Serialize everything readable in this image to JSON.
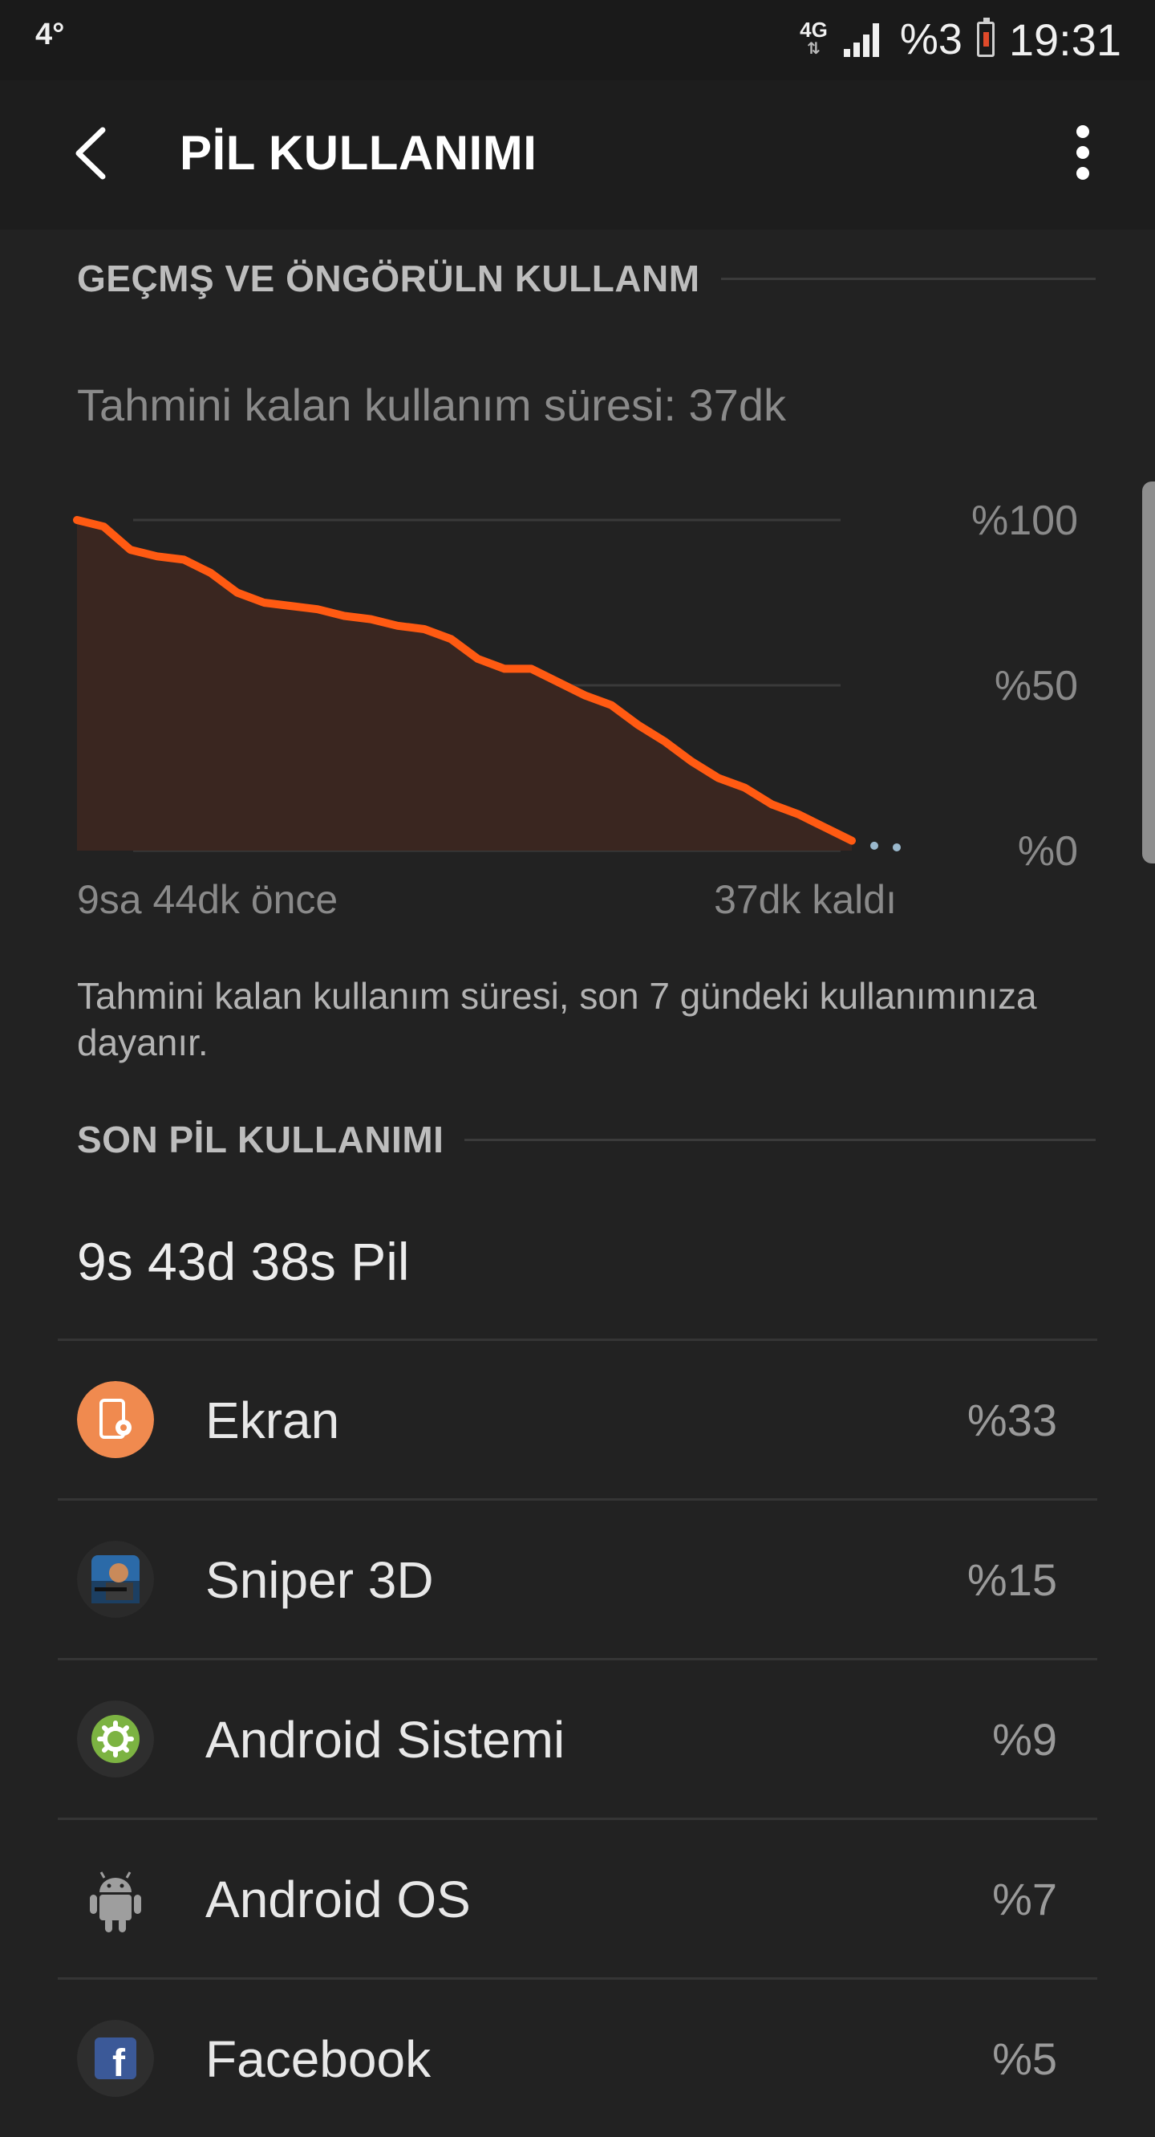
{
  "status_bar": {
    "temperature": "4°",
    "network_type": "4G",
    "battery_percent": "%3",
    "time": "19:31"
  },
  "app_bar": {
    "title": "PİL KULLANIMI"
  },
  "history_section": {
    "header": "GEÇMŞ VE ÖNGÖRÜLN KULLANM",
    "estimate": "Tahmini kalan kullanım süresi: 37dk",
    "caption": "Tahmini kalan kullanım süresi, son 7 gündeki kullanımınıza dayanır."
  },
  "chart_data": {
    "type": "area",
    "x_start_label": "9sa 44dk önce",
    "x_end_label": "37dk kaldı",
    "y_tick_labels": [
      "%100",
      "%50",
      "%0"
    ],
    "ylim": [
      0,
      100
    ],
    "grid": true,
    "series": [
      {
        "values": [
          100,
          98,
          91,
          89,
          88,
          84,
          78,
          75,
          74,
          73,
          71,
          70,
          68,
          67,
          64,
          58,
          55,
          55,
          51,
          47,
          44,
          38,
          33,
          27,
          22,
          19,
          14,
          11,
          7,
          3
        ]
      }
    ],
    "projection": [
      1,
      0.5
    ],
    "colors": {
      "line": "#ff5a12",
      "area": "#3a2620",
      "projection": "#9ab8cc"
    }
  },
  "recent_section": {
    "header": "SON PİL KULLANIMI",
    "total": "9s 43d 38s Pil"
  },
  "usage_items": [
    {
      "name": "Ekran",
      "percent": "%33",
      "icon": "screen-settings-icon"
    },
    {
      "name": "Sniper 3D",
      "percent": "%15",
      "icon": "sniper-3d-app-icon"
    },
    {
      "name": "Android Sistemi",
      "percent": "%9",
      "icon": "android-system-gear-icon"
    },
    {
      "name": "Android OS",
      "percent": "%7",
      "icon": "android-robot-icon"
    },
    {
      "name": "Facebook",
      "percent": "%5",
      "icon": "facebook-icon"
    }
  ]
}
